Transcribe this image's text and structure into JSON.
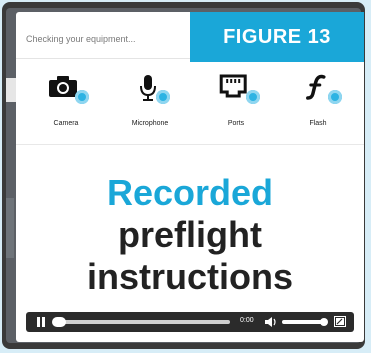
{
  "status": {
    "text": "Checking your equipment..."
  },
  "figure_label": "FIGURE 13",
  "checks": [
    {
      "label": "Camera",
      "icon": "camera-icon"
    },
    {
      "label": "Microphone",
      "icon": "microphone-icon"
    },
    {
      "label": "Ports",
      "icon": "ethernet-port-icon"
    },
    {
      "label": "Flash",
      "icon": "flash-icon"
    }
  ],
  "overlay": {
    "line1": "Recorded",
    "line2": "preflight",
    "line3": "instructions"
  },
  "player": {
    "time": "0:00",
    "progress": 0.0,
    "volume": 1.0
  },
  "colors": {
    "accent": "#1aa7d8",
    "spinner": "#2db3e3",
    "text_dark": "#222222",
    "player_bg": "#2b2b2b"
  }
}
